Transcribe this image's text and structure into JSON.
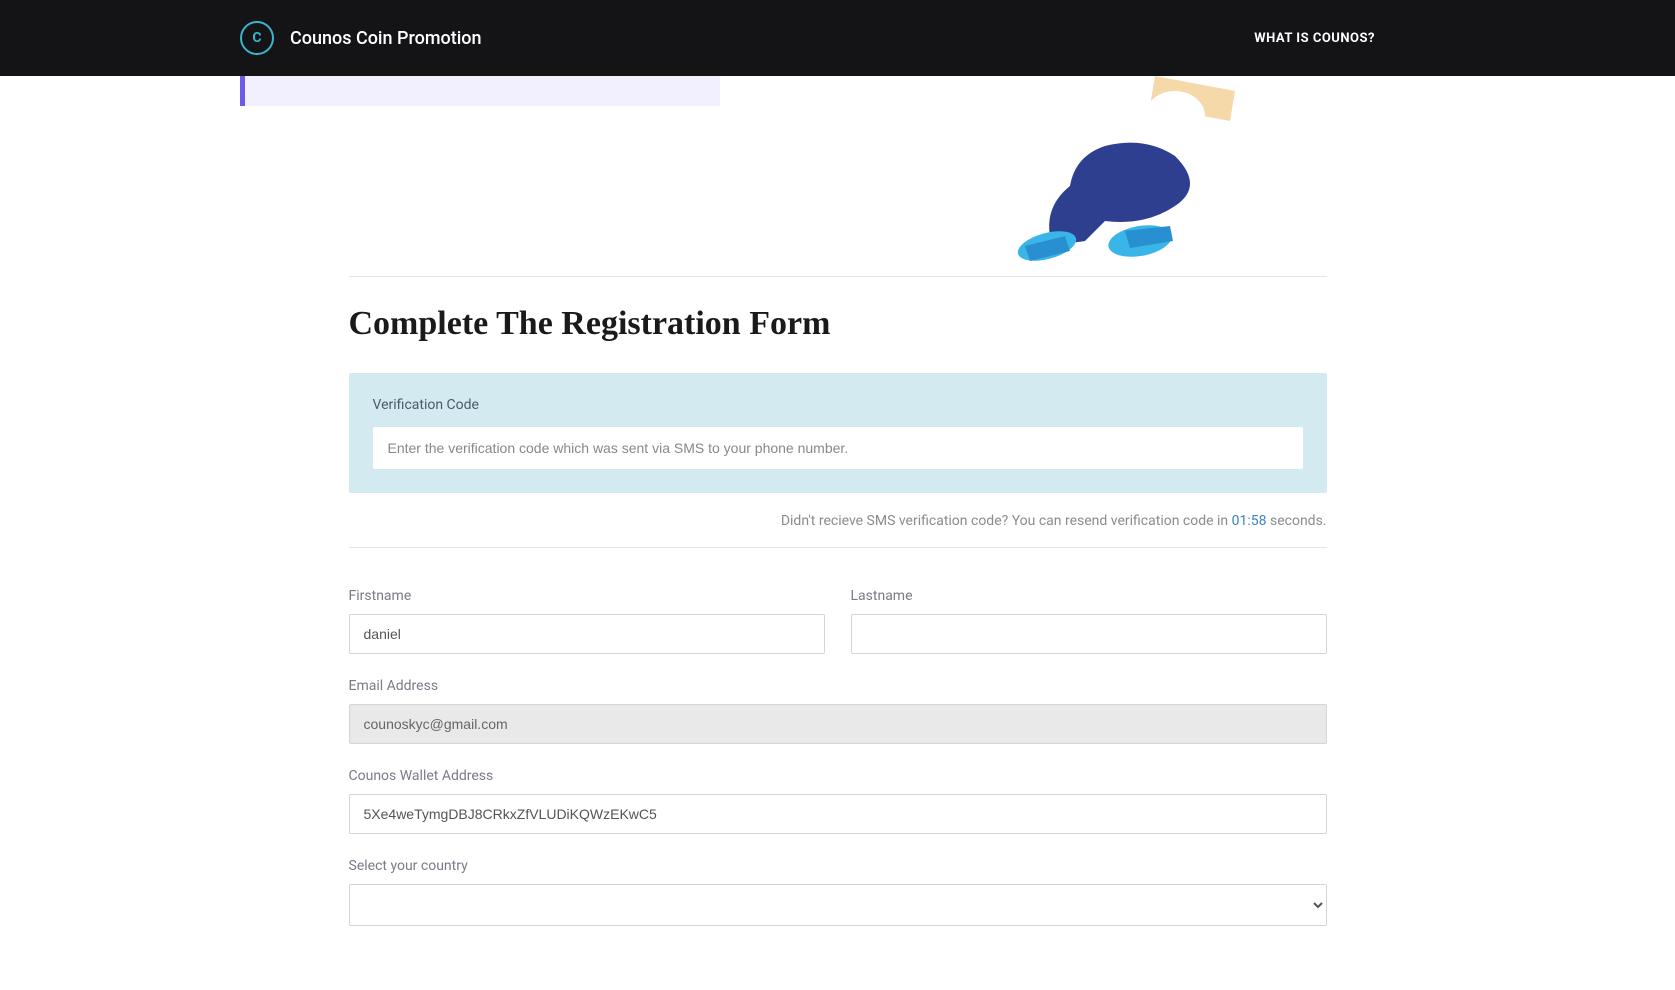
{
  "header": {
    "site_title": "Counos Coin Promotion",
    "nav_link": "WHAT IS COUNOS?"
  },
  "page": {
    "title": "Complete The Registration Form"
  },
  "verification": {
    "label": "Verification Code",
    "placeholder": "Enter the verification code which was sent via SMS to your phone number."
  },
  "resend": {
    "text_before": "Didn't recieve SMS verification code? You can resend verification code in ",
    "time": "01:58",
    "text_after": " seconds."
  },
  "form": {
    "firstname": {
      "label": "Firstname",
      "value": "daniel"
    },
    "lastname": {
      "label": "Lastname",
      "value": ""
    },
    "email": {
      "label": "Email Address",
      "value": "counoskyc@gmail.com"
    },
    "wallet": {
      "label": "Counos Wallet Address",
      "value": "5Xe4weTymgDBJ8CRkxZfVLUDiKQWzEKwC5"
    },
    "country": {
      "label": "Select your country"
    }
  }
}
